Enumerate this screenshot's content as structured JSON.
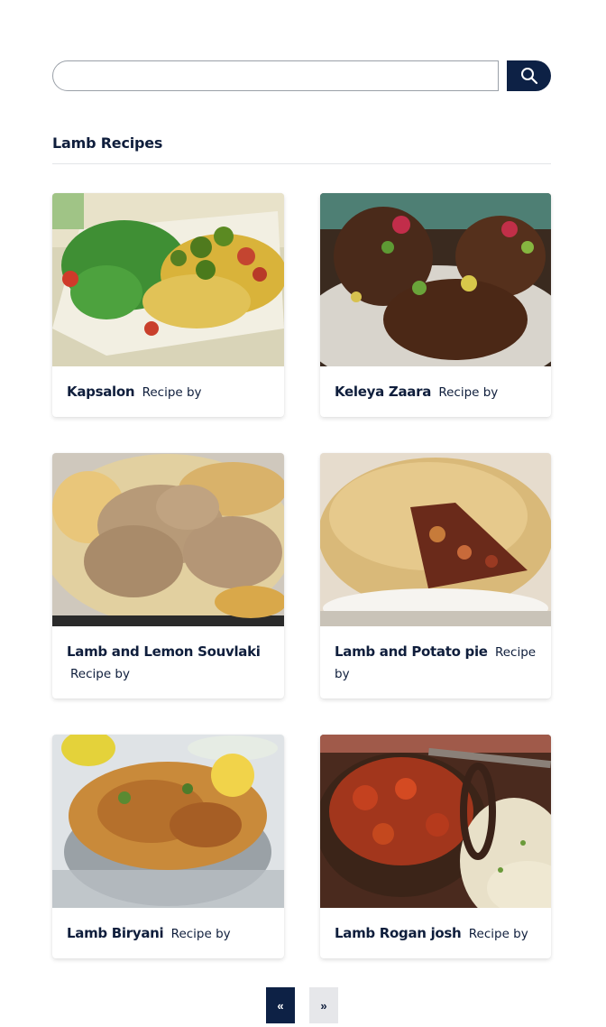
{
  "search": {
    "placeholder": "",
    "value": ""
  },
  "section": {
    "title": "Lamb Recipes"
  },
  "recipes": [
    {
      "title": "Kapsalon",
      "by": "Recipe by"
    },
    {
      "title": "Keleya Zaara",
      "by": "Recipe by"
    },
    {
      "title": "Lamb and Lemon Souvlaki",
      "by": "Recipe by"
    },
    {
      "title": "Lamb and Potato pie",
      "by": "Recipe by"
    },
    {
      "title": "Lamb Biryani",
      "by": "Recipe by"
    },
    {
      "title": "Lamb Rogan josh",
      "by": "Recipe by"
    }
  ],
  "pagination": {
    "prev": "«",
    "next": "»"
  },
  "colors": {
    "primary": "#0d2145",
    "text": "#0f1e3c",
    "divider": "#e3e5e8",
    "pager_inactive": "#e6e7ea"
  },
  "icons": {
    "search": "search-icon"
  }
}
